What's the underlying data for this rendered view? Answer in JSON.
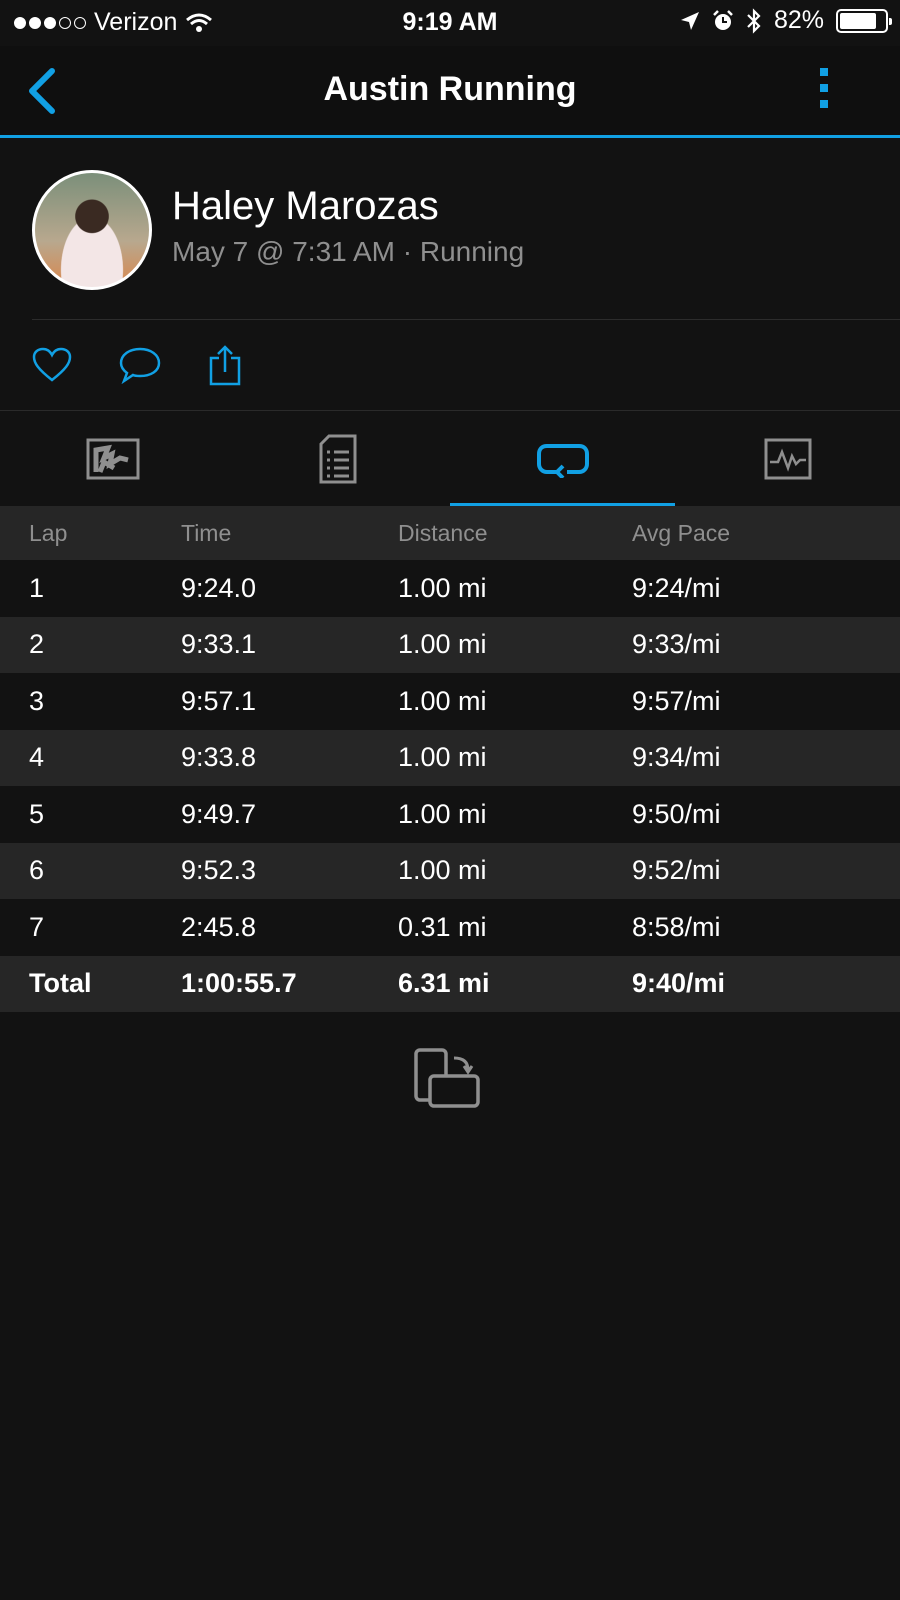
{
  "status": {
    "carrier": "Verizon",
    "time": "9:19 AM",
    "battery": "82%",
    "battery_level": 0.82
  },
  "nav": {
    "title": "Austin Running",
    "back_icon": "chevron-left-icon",
    "more_icon": "more-vertical-icon"
  },
  "activity": {
    "user_name": "Haley Marozas",
    "meta": "May 7 @ 7:31 AM · Running"
  },
  "actions": {
    "icons": [
      "heart-icon",
      "comment-icon",
      "share-icon"
    ]
  },
  "tabs": {
    "icons": [
      "map-icon",
      "details-icon",
      "laps-icon",
      "chart-icon"
    ],
    "active_index": 2
  },
  "laps": {
    "headers": [
      "Lap",
      "Time",
      "Distance",
      "Avg Pace"
    ],
    "rows": [
      [
        "1",
        "9:24.0",
        "1.00 mi",
        "9:24/mi"
      ],
      [
        "2",
        "9:33.1",
        "1.00 mi",
        "9:33/mi"
      ],
      [
        "3",
        "9:57.1",
        "1.00 mi",
        "9:57/mi"
      ],
      [
        "4",
        "9:33.8",
        "1.00 mi",
        "9:34/mi"
      ],
      [
        "5",
        "9:49.7",
        "1.00 mi",
        "9:50/mi"
      ],
      [
        "6",
        "9:52.3",
        "1.00 mi",
        "9:52/mi"
      ],
      [
        "7",
        "2:45.8",
        "0.31 mi",
        "8:58/mi"
      ]
    ],
    "total": [
      "Total",
      "1:00:55.7",
      "6.31 mi",
      "9:40/mi"
    ]
  },
  "colors": {
    "accent": "#11a0e4",
    "background": "#121212",
    "row_alt": "#262626",
    "muted_text": "#8f8f8f"
  }
}
